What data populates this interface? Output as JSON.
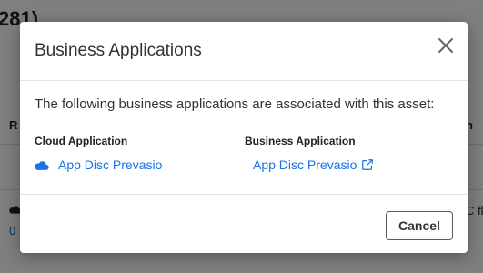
{
  "background": {
    "title_fragment": "281)",
    "column_left_fragment": "R",
    "column_right_fragment": "n",
    "link_fragment": "0",
    "cell_right_fragment": "C fl"
  },
  "dialog": {
    "title": "Business Applications",
    "intro": "The following business applications are associated with this asset:",
    "columns": {
      "cloud_heading": "Cloud Application",
      "business_heading": "Business Application"
    },
    "cloud_app": {
      "name": "App Disc Prevasio",
      "icon": "cloud-icon"
    },
    "business_app": {
      "name": "App Disc Prevasio",
      "icon": "external-link-icon"
    },
    "cancel_label": "Cancel",
    "close_icon": "close-icon"
  },
  "colors": {
    "link": "#1a73e8",
    "overlay": "rgba(0,0,0,0.5)"
  }
}
